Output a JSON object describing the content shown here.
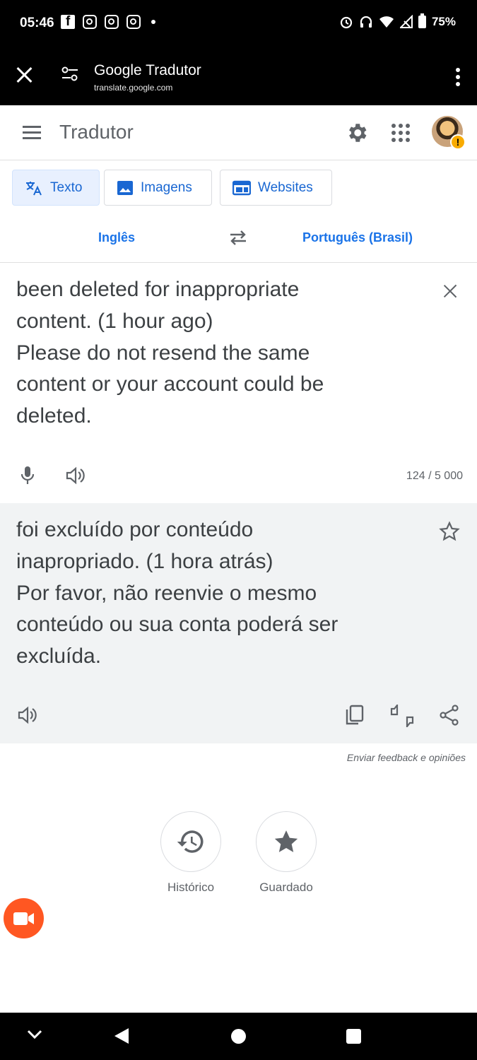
{
  "status_bar": {
    "time": "05:46",
    "battery": "75%"
  },
  "custom_tab": {
    "title": "Google Tradutor",
    "url": "translate.google.com"
  },
  "header": {
    "title": "Tradutor"
  },
  "modes": [
    {
      "label": "Texto"
    },
    {
      "label": "Imagens"
    },
    {
      "label": "Websites"
    }
  ],
  "languages": {
    "source": "Inglês",
    "target": "Português (Brasil)"
  },
  "source": {
    "lines": [
      "been deleted for inappropriate",
      "content. (1 hour ago)",
      "Please do not resend the same",
      "content or your account could be",
      "deleted."
    ],
    "char_count": "124 / 5 000"
  },
  "target": {
    "lines": [
      "foi excluído por conteúdo",
      "inapropriado. (1 hora atrás)",
      "Por favor, não reenvie o mesmo",
      "conteúdo ou sua conta poderá ser",
      "excluída."
    ]
  },
  "feedback_link": "Enviar feedback e opiniões",
  "bottom_actions": {
    "history": "Histórico",
    "saved": "Guardado"
  },
  "colors": {
    "accent": "#1a73e8",
    "fab": "#ff5722",
    "target_bg": "#f1f3f4"
  }
}
